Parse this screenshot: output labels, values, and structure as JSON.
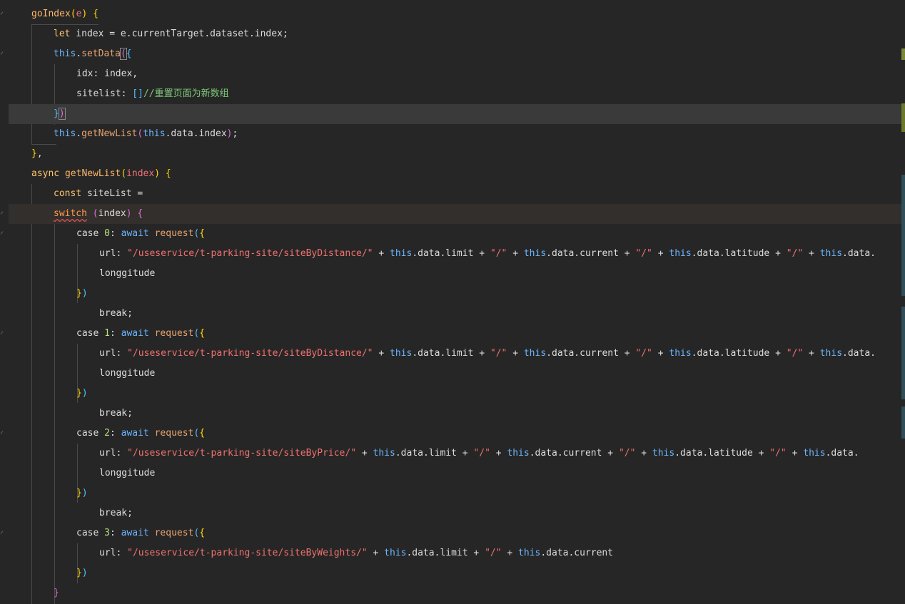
{
  "editor": {
    "language": "javascript",
    "colors": {
      "background": "#262626",
      "current_line": "#3a3a3a",
      "keyword": "#ffc66d",
      "string": "#f0716f",
      "this": "#6cb6ff",
      "comment": "#7fc97a"
    }
  },
  "lines": [
    [
      {
        "c": "t-fn",
        "t": "goIndex"
      },
      {
        "c": "t-br1",
        "t": "("
      },
      {
        "c": "t-param",
        "t": "e"
      },
      {
        "c": "t-br1",
        "t": ")"
      },
      {
        "c": "t-punc",
        "t": " "
      },
      {
        "c": "t-br1",
        "t": "{"
      }
    ],
    [
      {
        "c": "t-kw",
        "t": "let"
      },
      {
        "c": "t-plain",
        "t": " index = e.currentTarget.dataset.index;"
      }
    ],
    [
      {
        "c": "t-this",
        "t": "this"
      },
      {
        "c": "t-plain",
        "t": "."
      },
      {
        "c": "t-fnb",
        "t": "setData"
      },
      {
        "c": "t-br2 boxed",
        "t": "("
      },
      {
        "c": "t-br3",
        "t": "{"
      }
    ],
    [
      {
        "c": "t-key",
        "t": "idx"
      },
      {
        "c": "t-plain",
        "t": ": index,"
      }
    ],
    [
      {
        "c": "t-key",
        "t": "sitelist"
      },
      {
        "c": "t-plain",
        "t": ": "
      },
      {
        "c": "t-br3",
        "t": "[]"
      },
      {
        "c": "t-cmt",
        "t": "//重置页面为新数组"
      }
    ],
    [
      {
        "c": "t-br3",
        "t": "}"
      },
      {
        "c": "t-br2 boxed",
        "t": ")"
      }
    ],
    [
      {
        "c": "t-this",
        "t": "this"
      },
      {
        "c": "t-plain",
        "t": "."
      },
      {
        "c": "t-fnb",
        "t": "getNewList"
      },
      {
        "c": "t-br2",
        "t": "("
      },
      {
        "c": "t-this",
        "t": "this"
      },
      {
        "c": "t-plain",
        "t": ".data.index"
      },
      {
        "c": "t-br2",
        "t": ")"
      },
      {
        "c": "t-plain",
        "t": ";"
      }
    ],
    [
      {
        "c": "t-br1",
        "t": "}"
      },
      {
        "c": "t-plain",
        "t": ","
      }
    ],
    [
      {
        "c": "t-kw",
        "t": "async"
      },
      {
        "c": "t-plain",
        "t": " "
      },
      {
        "c": "t-fn",
        "t": "getNewList"
      },
      {
        "c": "t-br1",
        "t": "("
      },
      {
        "c": "t-param",
        "t": "index"
      },
      {
        "c": "t-br1",
        "t": ")"
      },
      {
        "c": "t-plain",
        "t": " "
      },
      {
        "c": "t-br1",
        "t": "{"
      }
    ],
    [
      {
        "c": "t-kw",
        "t": "const"
      },
      {
        "c": "t-plain",
        "t": " siteList ="
      }
    ],
    [
      {
        "c": "t-ctrl squiggle",
        "t": "switch"
      },
      {
        "c": "t-plain",
        "t": " "
      },
      {
        "c": "t-br2",
        "t": "("
      },
      {
        "c": "t-plain",
        "t": "index"
      },
      {
        "c": "t-br2",
        "t": ")"
      },
      {
        "c": "t-plain",
        "t": " "
      },
      {
        "c": "t-br2",
        "t": "{"
      }
    ],
    [
      {
        "c": "t-plain",
        "t": "case "
      },
      {
        "c": "t-num",
        "t": "0"
      },
      {
        "c": "t-plain",
        "t": ": "
      },
      {
        "c": "t-this",
        "t": "await"
      },
      {
        "c": "t-plain",
        "t": " "
      },
      {
        "c": "t-fnb",
        "t": "request"
      },
      {
        "c": "t-br3",
        "t": "("
      },
      {
        "c": "t-br1",
        "t": "{"
      }
    ],
    [
      {
        "c": "t-key",
        "t": "url"
      },
      {
        "c": "t-plain",
        "t": ": "
      },
      {
        "c": "t-str",
        "t": "\"/useservice/t-parking-site/siteByDistance/\""
      },
      {
        "c": "t-plain",
        "t": " + "
      },
      {
        "c": "t-this",
        "t": "this"
      },
      {
        "c": "t-plain",
        "t": ".data.limit + "
      },
      {
        "c": "t-str",
        "t": "\"/\""
      },
      {
        "c": "t-plain",
        "t": " + "
      },
      {
        "c": "t-this",
        "t": "this"
      },
      {
        "c": "t-plain",
        "t": ".data.current + "
      },
      {
        "c": "t-str",
        "t": "\"/\""
      },
      {
        "c": "t-plain",
        "t": " + "
      },
      {
        "c": "t-this",
        "t": "this"
      },
      {
        "c": "t-plain",
        "t": ".data.latitude + "
      },
      {
        "c": "t-str",
        "t": "\"/\""
      },
      {
        "c": "t-plain",
        "t": " + "
      },
      {
        "c": "t-this",
        "t": "this"
      },
      {
        "c": "t-plain",
        "t": ".data."
      }
    ],
    [
      {
        "c": "t-plain",
        "t": "longgitude"
      }
    ],
    [
      {
        "c": "t-br1",
        "t": "}"
      },
      {
        "c": "t-br3",
        "t": ")"
      }
    ],
    [
      {
        "c": "t-plain",
        "t": "break;"
      }
    ],
    [
      {
        "c": "t-plain",
        "t": "case "
      },
      {
        "c": "t-num",
        "t": "1"
      },
      {
        "c": "t-plain",
        "t": ": "
      },
      {
        "c": "t-this",
        "t": "await"
      },
      {
        "c": "t-plain",
        "t": " "
      },
      {
        "c": "t-fnb",
        "t": "request"
      },
      {
        "c": "t-br3",
        "t": "("
      },
      {
        "c": "t-br1",
        "t": "{"
      }
    ],
    [
      {
        "c": "t-key",
        "t": "url"
      },
      {
        "c": "t-plain",
        "t": ": "
      },
      {
        "c": "t-str",
        "t": "\"/useservice/t-parking-site/siteByDistance/\""
      },
      {
        "c": "t-plain",
        "t": " + "
      },
      {
        "c": "t-this",
        "t": "this"
      },
      {
        "c": "t-plain",
        "t": ".data.limit + "
      },
      {
        "c": "t-str",
        "t": "\"/\""
      },
      {
        "c": "t-plain",
        "t": " + "
      },
      {
        "c": "t-this",
        "t": "this"
      },
      {
        "c": "t-plain",
        "t": ".data.current + "
      },
      {
        "c": "t-str",
        "t": "\"/\""
      },
      {
        "c": "t-plain",
        "t": " + "
      },
      {
        "c": "t-this",
        "t": "this"
      },
      {
        "c": "t-plain",
        "t": ".data.latitude + "
      },
      {
        "c": "t-str",
        "t": "\"/\""
      },
      {
        "c": "t-plain",
        "t": " + "
      },
      {
        "c": "t-this",
        "t": "this"
      },
      {
        "c": "t-plain",
        "t": ".data."
      }
    ],
    [
      {
        "c": "t-plain",
        "t": "longgitude"
      }
    ],
    [
      {
        "c": "t-br1",
        "t": "}"
      },
      {
        "c": "t-br3",
        "t": ")"
      }
    ],
    [
      {
        "c": "t-plain",
        "t": "break;"
      }
    ],
    [
      {
        "c": "t-plain",
        "t": "case "
      },
      {
        "c": "t-num",
        "t": "2"
      },
      {
        "c": "t-plain",
        "t": ": "
      },
      {
        "c": "t-this",
        "t": "await"
      },
      {
        "c": "t-plain",
        "t": " "
      },
      {
        "c": "t-fnb",
        "t": "request"
      },
      {
        "c": "t-br3",
        "t": "("
      },
      {
        "c": "t-br1",
        "t": "{"
      }
    ],
    [
      {
        "c": "t-key",
        "t": "url"
      },
      {
        "c": "t-plain",
        "t": ": "
      },
      {
        "c": "t-str",
        "t": "\"/useservice/t-parking-site/siteByPrice/\""
      },
      {
        "c": "t-plain",
        "t": " + "
      },
      {
        "c": "t-this",
        "t": "this"
      },
      {
        "c": "t-plain",
        "t": ".data.limit + "
      },
      {
        "c": "t-str",
        "t": "\"/\""
      },
      {
        "c": "t-plain",
        "t": " + "
      },
      {
        "c": "t-this",
        "t": "this"
      },
      {
        "c": "t-plain",
        "t": ".data.current + "
      },
      {
        "c": "t-str",
        "t": "\"/\""
      },
      {
        "c": "t-plain",
        "t": " + "
      },
      {
        "c": "t-this",
        "t": "this"
      },
      {
        "c": "t-plain",
        "t": ".data.latitude + "
      },
      {
        "c": "t-str",
        "t": "\"/\""
      },
      {
        "c": "t-plain",
        "t": " + "
      },
      {
        "c": "t-this",
        "t": "this"
      },
      {
        "c": "t-plain",
        "t": ".data."
      }
    ],
    [
      {
        "c": "t-plain",
        "t": "longgitude"
      }
    ],
    [
      {
        "c": "t-br1",
        "t": "}"
      },
      {
        "c": "t-br3",
        "t": ")"
      }
    ],
    [
      {
        "c": "t-plain",
        "t": "break;"
      }
    ],
    [
      {
        "c": "t-plain",
        "t": "case "
      },
      {
        "c": "t-num",
        "t": "3"
      },
      {
        "c": "t-plain",
        "t": ": "
      },
      {
        "c": "t-this",
        "t": "await"
      },
      {
        "c": "t-plain",
        "t": " "
      },
      {
        "c": "t-fnb",
        "t": "request"
      },
      {
        "c": "t-br3",
        "t": "("
      },
      {
        "c": "t-br1",
        "t": "{"
      }
    ],
    [
      {
        "c": "t-key",
        "t": "url"
      },
      {
        "c": "t-plain",
        "t": ": "
      },
      {
        "c": "t-str",
        "t": "\"/useservice/t-parking-site/siteByWeights/\""
      },
      {
        "c": "t-plain",
        "t": " + "
      },
      {
        "c": "t-this",
        "t": "this"
      },
      {
        "c": "t-plain",
        "t": ".data.limit + "
      },
      {
        "c": "t-str",
        "t": "\"/\""
      },
      {
        "c": "t-plain",
        "t": " + "
      },
      {
        "c": "t-this",
        "t": "this"
      },
      {
        "c": "t-plain",
        "t": ".data.current"
      }
    ],
    [
      {
        "c": "t-br1",
        "t": "}"
      },
      {
        "c": "t-br3",
        "t": ")"
      }
    ],
    [
      {
        "c": "t-br2",
        "t": "}"
      }
    ]
  ]
}
